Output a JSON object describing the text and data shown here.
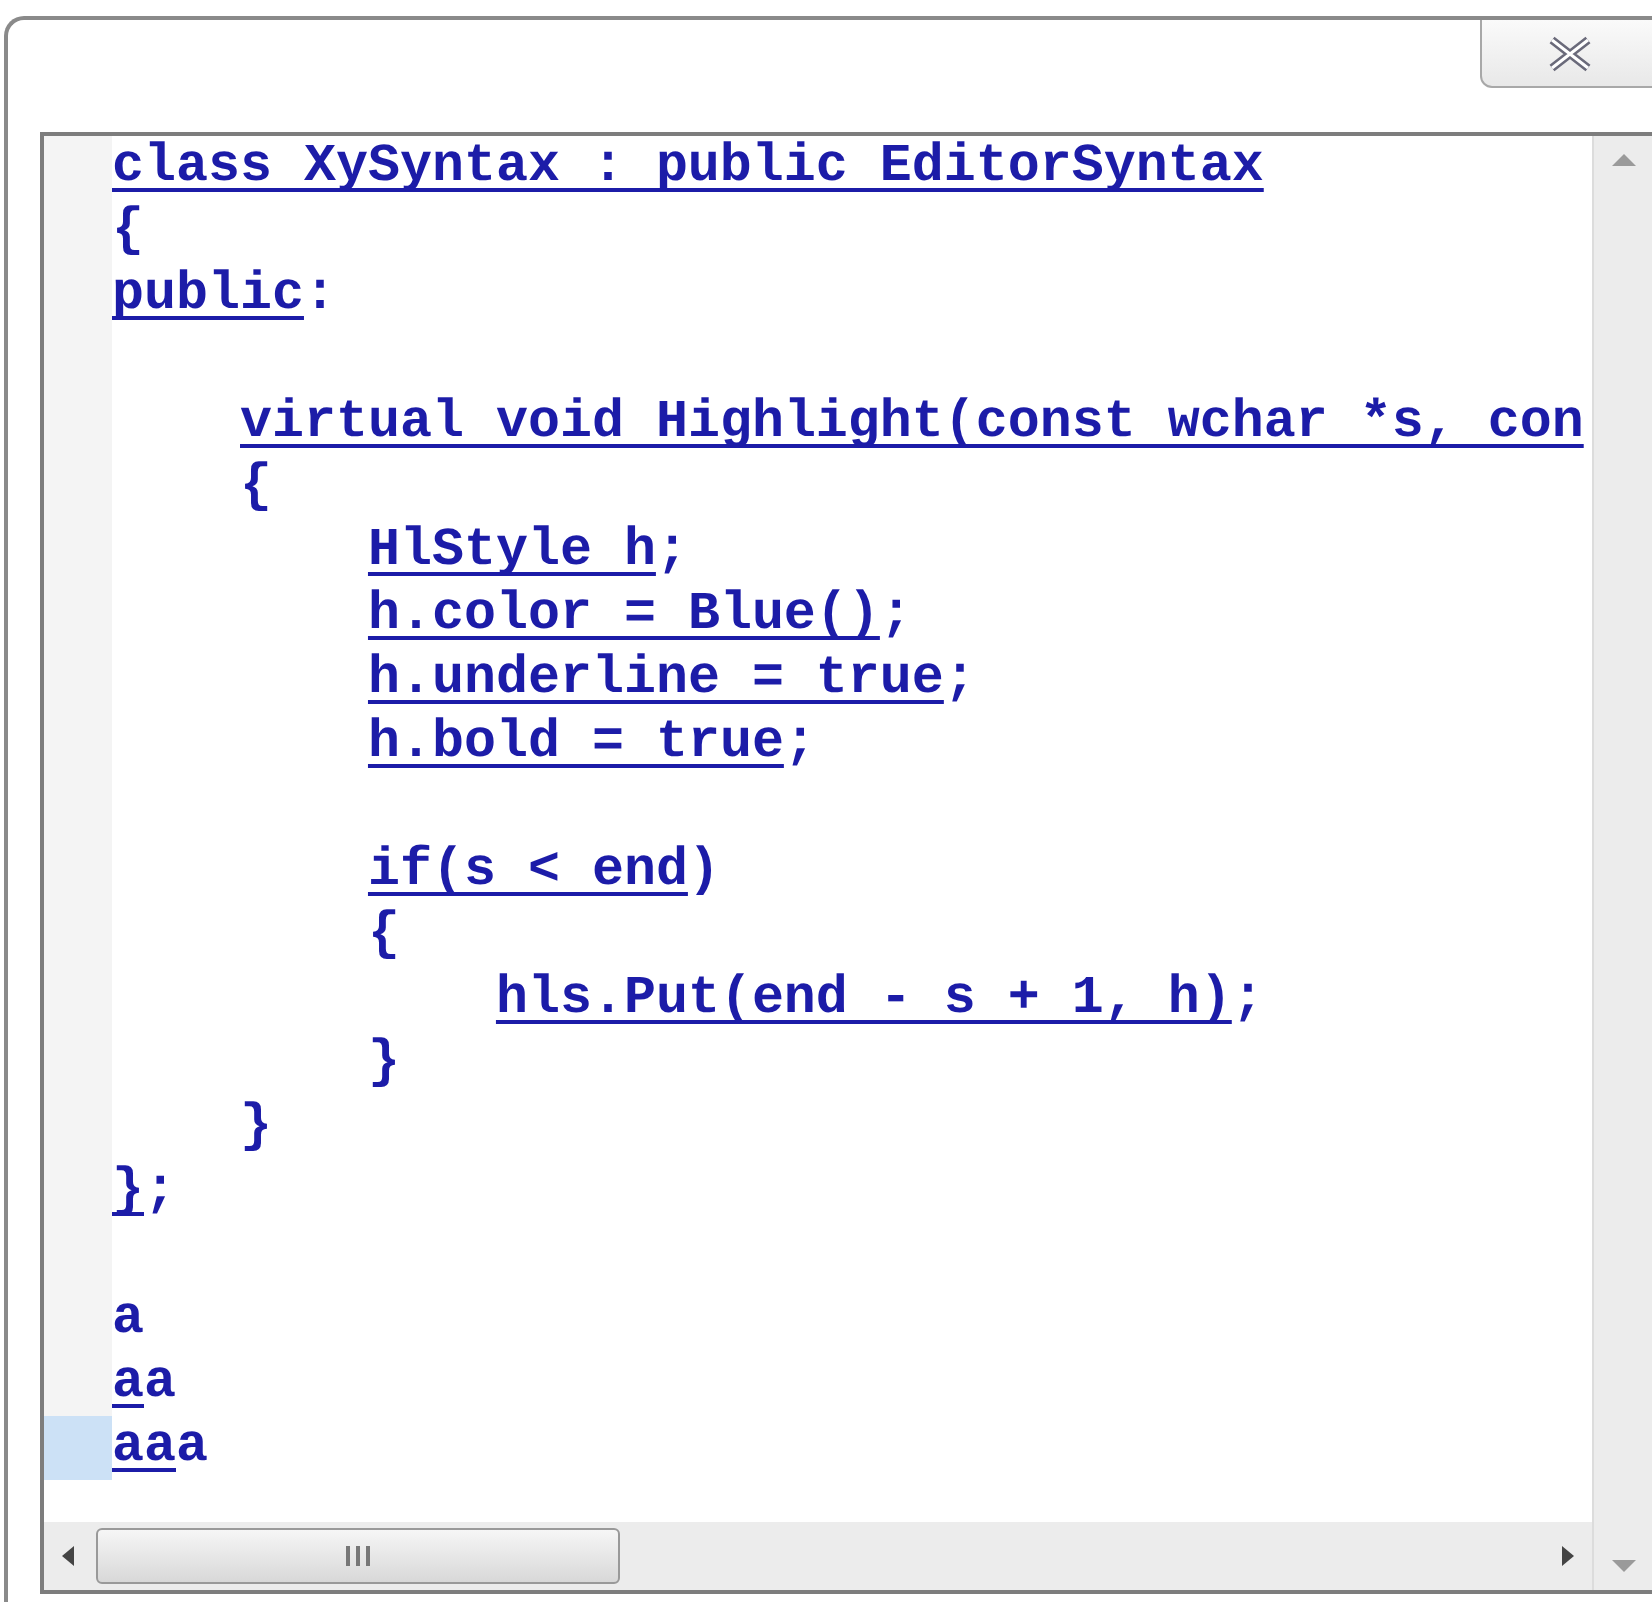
{
  "editor": {
    "lines": [
      {
        "selected": false,
        "segments": [
          {
            "text": "class XySyntax : public EditorSyntax",
            "underlined": true
          }
        ]
      },
      {
        "selected": false,
        "segments": [
          {
            "text": "{",
            "underlined": false
          }
        ]
      },
      {
        "selected": false,
        "segments": [
          {
            "text": "public",
            "underlined": true
          },
          {
            "text": ":",
            "underlined": false
          }
        ]
      },
      {
        "selected": false
      },
      {
        "selected": false,
        "segments": [
          {
            "text": "    virtual void Highlight(const wchar *s, con",
            "underlined": true
          }
        ]
      },
      {
        "selected": false,
        "segments": [
          {
            "text": "    {",
            "underlined": false
          }
        ]
      },
      {
        "selected": false,
        "segments": [
          {
            "text": "        HlStyle h",
            "underlined": true
          },
          {
            "text": ";",
            "underlined": false
          }
        ]
      },
      {
        "selected": false,
        "segments": [
          {
            "text": "        h.color = Blue()",
            "underlined": true
          },
          {
            "text": ";",
            "underlined": false
          }
        ]
      },
      {
        "selected": false,
        "segments": [
          {
            "text": "        h.underline = true",
            "underlined": true
          },
          {
            "text": ";",
            "underlined": false
          }
        ]
      },
      {
        "selected": false,
        "segments": [
          {
            "text": "        h.bold = true",
            "underlined": true
          },
          {
            "text": ";",
            "underlined": false
          }
        ]
      },
      {
        "selected": false
      },
      {
        "selected": false,
        "segments": [
          {
            "text": "        if(s < end",
            "underlined": true
          },
          {
            "text": ")",
            "underlined": false
          }
        ]
      },
      {
        "selected": false,
        "segments": [
          {
            "text": "        {",
            "underlined": false
          }
        ]
      },
      {
        "selected": false,
        "segments": [
          {
            "text": "            hls.Put(end - s + 1, h)",
            "underlined": true
          },
          {
            "text": ";",
            "underlined": false
          }
        ]
      },
      {
        "selected": false,
        "segments": [
          {
            "text": "        }",
            "underlined": false
          }
        ]
      },
      {
        "selected": false,
        "segments": [
          {
            "text": "    }",
            "underlined": false
          }
        ]
      },
      {
        "selected": false,
        "segments": [
          {
            "text": "}",
            "underlined": true
          },
          {
            "text": ";",
            "underlined": false
          }
        ]
      },
      {
        "selected": false
      },
      {
        "selected": false,
        "segments": [
          {
            "text": "a",
            "underlined": false
          }
        ]
      },
      {
        "selected": false,
        "segments": [
          {
            "text": "a",
            "underlined": true
          },
          {
            "text": "a",
            "underlined": false
          }
        ]
      },
      {
        "selected": true,
        "segments": [
          {
            "text": "aa",
            "underlined": true
          },
          {
            "text": "a",
            "underlined": false
          }
        ]
      }
    ]
  }
}
